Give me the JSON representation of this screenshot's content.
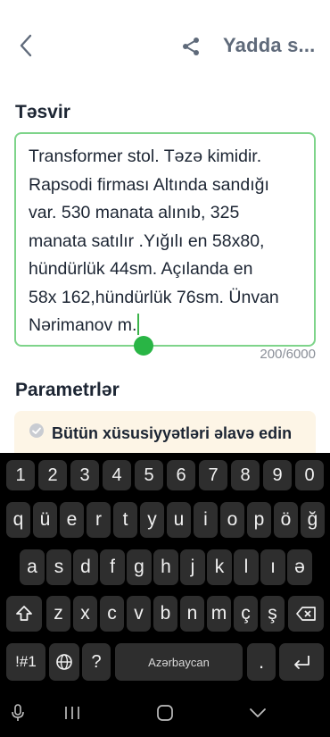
{
  "header": {
    "save_label": "Yadda s...",
    "back_icon": "chevron-left-icon",
    "share_icon": "share-icon"
  },
  "description": {
    "title": "Təsvir",
    "text": "Transformer stol. Təzə kimidir.\nRapsodi firması Altında   sandığı\nvar. 530 manata alınıb, 325\nmanata satılır .Yığılı  en 58x80,\nhündürlük 44sm. Açılanda  en\n58x 162,hündürlük 76sm. Ünvan\nNərimanov m.",
    "char_count": "200/6000"
  },
  "parameters": {
    "title": "Parametrlər",
    "add_all_label": "Bütün xüsusiyyətləri əlavə edin"
  },
  "keyboard": {
    "row_numbers": [
      "1",
      "2",
      "3",
      "4",
      "5",
      "6",
      "7",
      "8",
      "9",
      "0"
    ],
    "row1": [
      "q",
      "ü",
      "e",
      "r",
      "t",
      "y",
      "u",
      "i",
      "o",
      "p",
      "ö",
      "ğ"
    ],
    "row2": [
      "a",
      "s",
      "d",
      "f",
      "g",
      "h",
      "j",
      "k",
      "l",
      "ı",
      "ə"
    ],
    "row3": [
      "z",
      "x",
      "c",
      "v",
      "b",
      "n",
      "m",
      "ç",
      "ş"
    ],
    "symbols_label": "!#1",
    "question_label": "?",
    "space_label": "Azərbaycan",
    "period_label": "."
  },
  "colors": {
    "accent_green": "#29b545",
    "border_green": "#7ed48a",
    "card_bg": "#fdf5e6",
    "keyboard_bg": "#000000",
    "key_bg": "#2e2e2e"
  }
}
